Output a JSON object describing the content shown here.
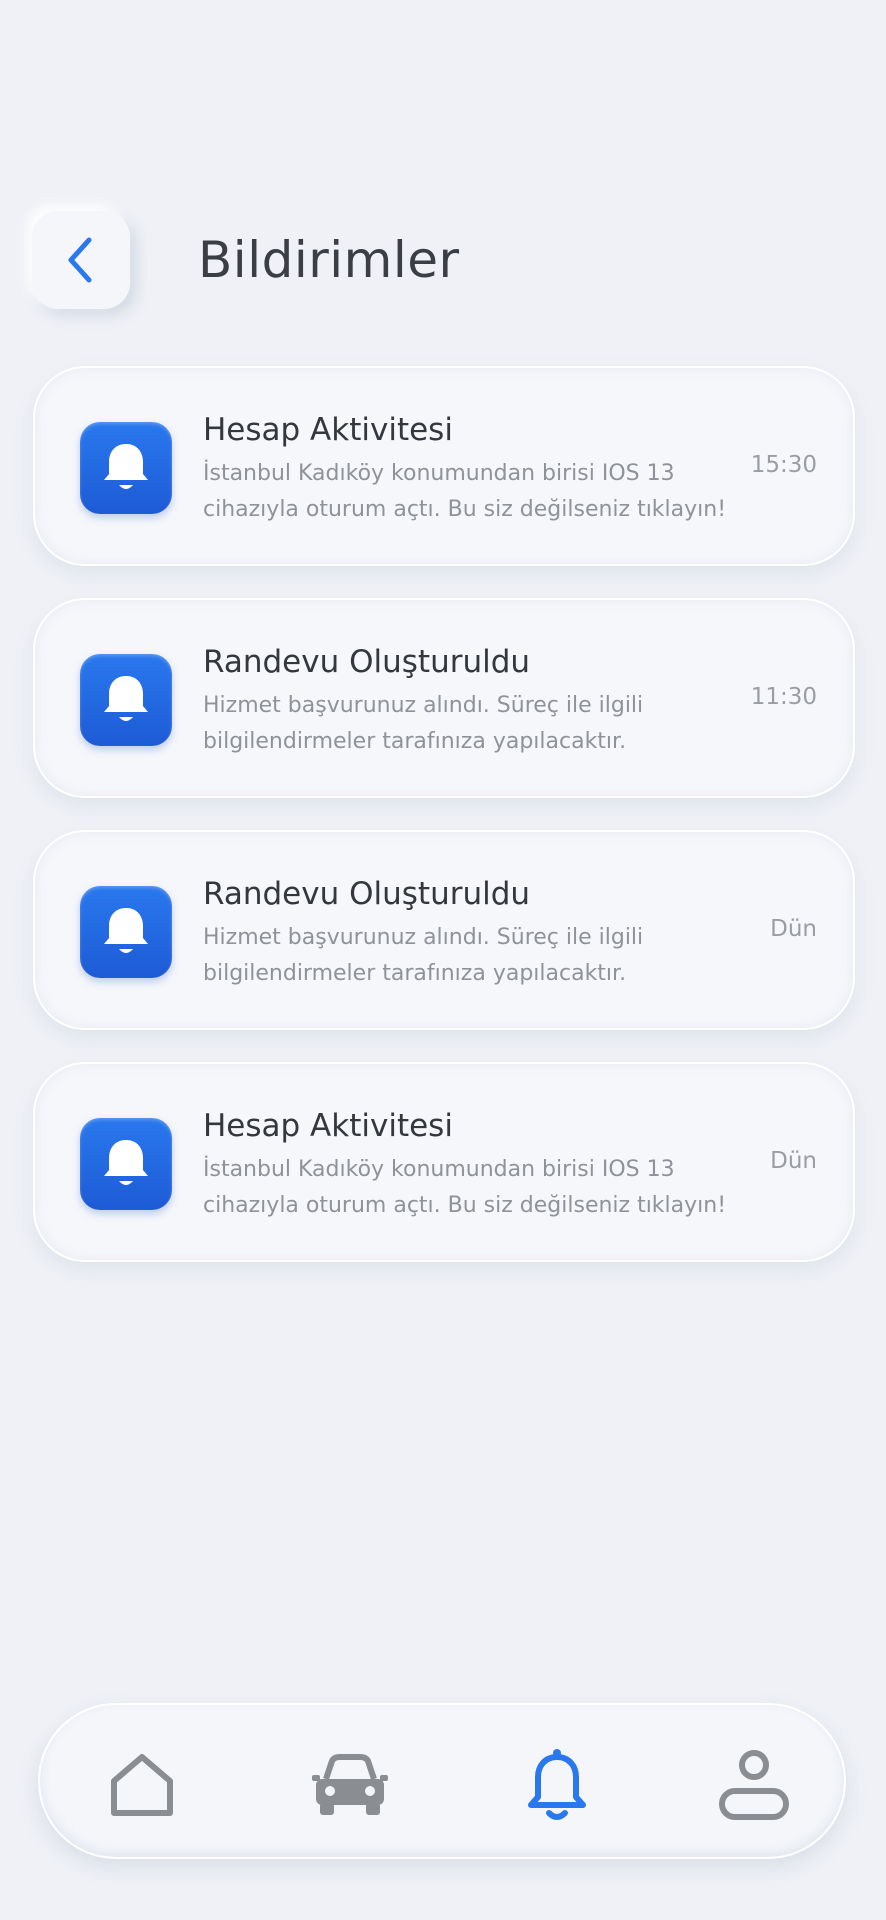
{
  "header": {
    "title": "Bildirimler",
    "back_icon": "chevron-left-icon"
  },
  "notifications": [
    {
      "title": "Hesap Aktivitesi",
      "body_line1": "İstanbul Kadıköy konumundan birisi IOS 13",
      "body_line2": "cihazıyla oturum açtı. Bu siz değilseniz tıklayın!",
      "time": "15:30",
      "icon": "bell-icon"
    },
    {
      "title": "Randevu Oluşturuldu",
      "body_line1": "Hizmet başvurunuz alındı. Süreç ile ilgili",
      "body_line2": "bilgilendirmeler tarafınıza yapılacaktır.",
      "time": "11:30",
      "icon": "bell-icon"
    },
    {
      "title": "Randevu Oluşturuldu",
      "body_line1": "Hizmet başvurunuz alındı. Süreç ile ilgili",
      "body_line2": "bilgilendirmeler tarafınıza yapılacaktır.",
      "time": "Dün",
      "icon": "bell-icon"
    },
    {
      "title": "Hesap Aktivitesi",
      "body_line1": "İstanbul Kadıköy konumundan birisi IOS 13",
      "body_line2": "cihazıyla oturum açtı. Bu siz değilseniz tıklayın!",
      "time": "Dün",
      "icon": "bell-icon"
    }
  ],
  "tabbar": {
    "items": [
      {
        "icon": "home-icon",
        "active": false
      },
      {
        "icon": "car-icon",
        "active": false
      },
      {
        "icon": "bell-icon",
        "active": true
      },
      {
        "icon": "user-icon",
        "active": false
      }
    ]
  },
  "colors": {
    "accent": "#2a78ee",
    "background": "#eff1f6",
    "inactive_icon": "#8a8d92",
    "title_text": "#3b3f45",
    "body_text": "#8f9399"
  }
}
